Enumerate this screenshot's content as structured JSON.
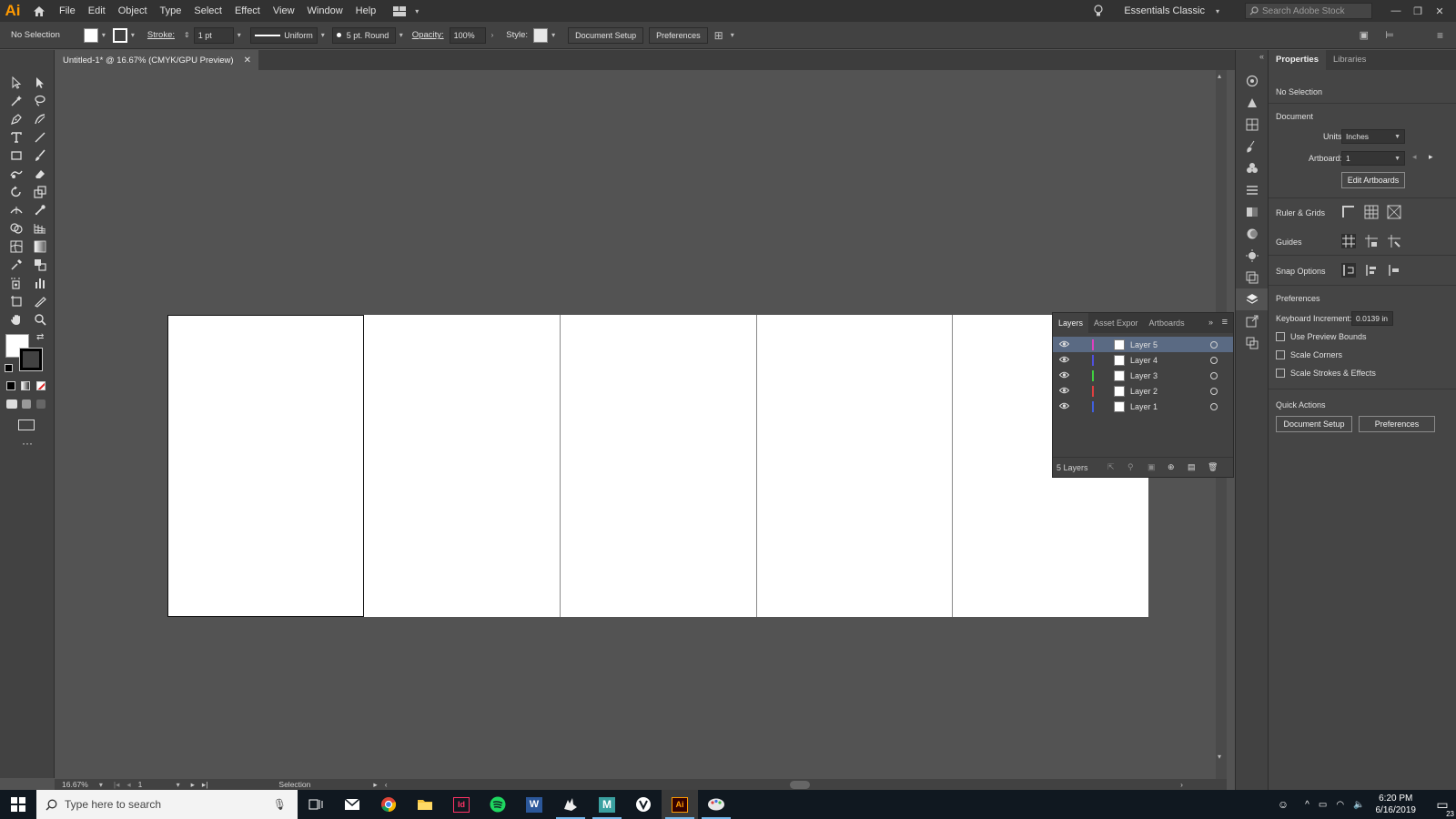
{
  "app": {
    "logo": "Ai",
    "window_title": "Adobe Illustrator"
  },
  "menu": [
    "File",
    "Edit",
    "Object",
    "Type",
    "Select",
    "Effect",
    "View",
    "Window",
    "Help"
  ],
  "menubar_right": {
    "workspace": "Essentials Classic",
    "search_placeholder": "Search Adobe Stock"
  },
  "control": {
    "selection": "No Selection",
    "stroke_label": "Stroke:",
    "stroke_weight": "1 pt",
    "stroke_profile": "Uniform",
    "brush": "5 pt. Round",
    "opacity_label": "Opacity:",
    "opacity_value": "100%",
    "style_label": "Style:",
    "doc_setup": "Document Setup",
    "preferences": "Preferences"
  },
  "document": {
    "tab_title": "Untitled-1* @ 16.67% (CMYK/GPU Preview)",
    "artboard_count": 5
  },
  "status": {
    "zoom": "16.67%",
    "artboard_num": "1",
    "tool": "Selection"
  },
  "properties": {
    "tabs": [
      "Properties",
      "Libraries"
    ],
    "selection": "No Selection",
    "document_title": "Document",
    "units_label": "Units:",
    "units_value": "Inches",
    "artboard_label": "Artboard:",
    "artboard_value": "1",
    "edit_artboards": "Edit Artboards",
    "ruler_grids": "Ruler & Grids",
    "guides": "Guides",
    "snap_options": "Snap Options",
    "preferences_title": "Preferences",
    "keyboard_inc_label": "Keyboard Increment:",
    "keyboard_inc_value": "0.0139 in",
    "checks": [
      "Use Preview Bounds",
      "Scale Corners",
      "Scale Strokes & Effects"
    ],
    "quick_actions": "Quick Actions",
    "qa_doc_setup": "Document Setup",
    "qa_preferences": "Preferences"
  },
  "layers_panel": {
    "tabs": [
      "Layers",
      "Asset Expor",
      "Artboards"
    ],
    "layers": [
      {
        "name": "Layer 5",
        "color": "#e040c0",
        "selected": true
      },
      {
        "name": "Layer 4",
        "color": "#5050e0",
        "selected": false
      },
      {
        "name": "Layer 3",
        "color": "#40d040",
        "selected": false
      },
      {
        "name": "Layer 2",
        "color": "#e04040",
        "selected": false
      },
      {
        "name": "Layer 1",
        "color": "#4060e0",
        "selected": false
      }
    ],
    "count_label": "5 Layers"
  },
  "taskbar": {
    "search_placeholder": "Type here to search",
    "apps": [
      "task-view",
      "mail",
      "chrome",
      "file-explorer",
      "indesign",
      "spotify",
      "word",
      "rhino",
      "m-app",
      "vectorworks",
      "illustrator",
      "paint"
    ],
    "time": "6:20 PM",
    "date": "6/16/2019",
    "notification_count": "23"
  }
}
